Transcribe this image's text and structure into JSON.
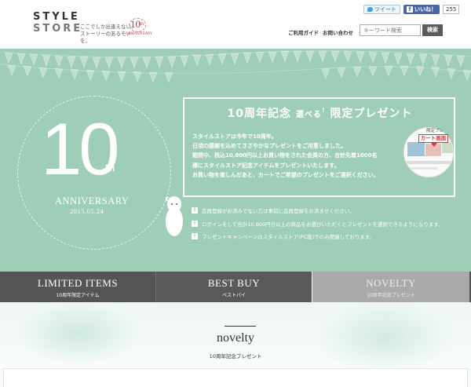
{
  "header": {
    "logo_line1": "STYLE",
    "logo_line2": "STORE",
    "tagline_line1": "ここでしか出逢えない、",
    "tagline_line2": "ストーリーのあるモノを。",
    "badge_number": "10",
    "badge_suffix": "th",
    "badge_text": "ANNIVERSARY",
    "tweet_label": "ツイート",
    "like_label": "いいね！",
    "like_count": "255",
    "nav": [
      "ご利用ガイド",
      "お問い合わせ"
    ],
    "search_placeholder": "キーワード検索",
    "search_button": "検索"
  },
  "hero": {
    "number": "10",
    "suffix": "th",
    "anniversary": "ANNIVERSARY",
    "date": "2015.05.24",
    "title_main": "10周年記念",
    "title_small": "選べる",
    "title_excl": "!",
    "title_tail": "限定プレゼント",
    "text_lines": [
      "スタイルストアは今年で10周年。",
      "日頃の感謝を込めてささやかなプレゼントをご用意しました。",
      "期間中、税込10,800円以上お買い物をされた会員の方、合計先着1000名",
      "様にスタイルストア記念アイテムをプレゼントいたします。",
      "お買い物を楽しんだあと、カートでご希望のプレゼントをご選択ください。"
    ],
    "promo_label": "限定プレ",
    "cart_label": "カート画面",
    "notices": [
      "会員登録がお済みでない方は事前に会員登録をお済ませください。",
      "ログインをして合計10,800円分以上の商品をお選びいただくとプレゼントを選択できるようになります。",
      "プレゼントキャンペーンはスタイルストア(PC版)でのみ開催しております。"
    ],
    "notice_mark": "!"
  },
  "tabs": [
    {
      "title": "LIMITED ITEMS",
      "sub": "10周年限定アイテム"
    },
    {
      "title": "BEST BUY",
      "sub": "ベストバイ"
    },
    {
      "title": "NOVELTY",
      "sub": "10周年記念プレゼント"
    }
  ],
  "section": {
    "title": "novelty",
    "subtitle": "10周年記念プレゼント"
  },
  "colors": {
    "hero_bg": "#9ecdb8",
    "tab_dark": "#555555",
    "tab_active": "#aaaaaa",
    "accent_red": "#c03a3a"
  }
}
